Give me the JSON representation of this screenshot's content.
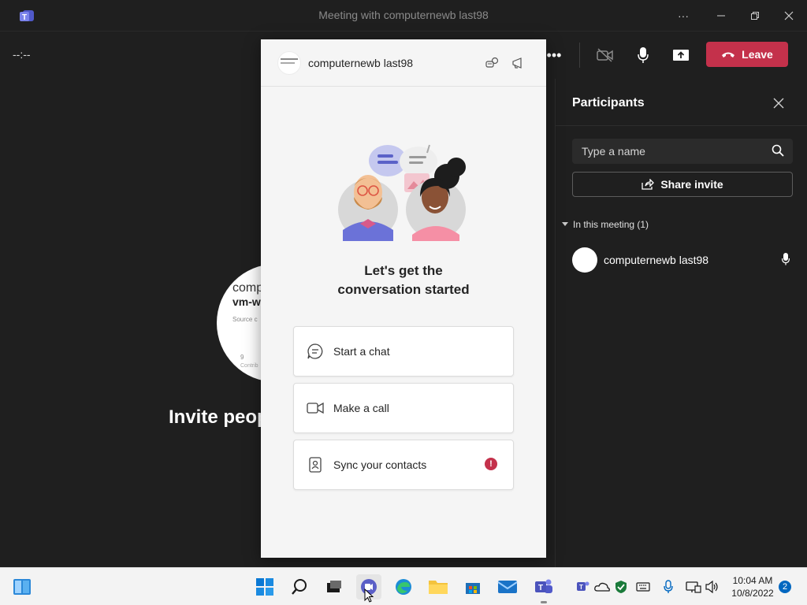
{
  "window": {
    "title": "Meeting with computernewb last98",
    "app_icon": "teams-icon"
  },
  "meeting_bar": {
    "timer": "--:--",
    "leave_label": "Leave",
    "leave_color": "#c4314b"
  },
  "stage": {
    "invite_text": "Invite peop",
    "avatar_lines": [
      "comp",
      "vm-w",
      "Source c",
      "9",
      "Contrib"
    ]
  },
  "participants_panel": {
    "title": "Participants",
    "search_placeholder": "Type a name",
    "share_invite_label": "Share invite",
    "section_label": "In this meeting (1)",
    "participants": [
      {
        "name": "computernewb last98",
        "mic": "mic-icon"
      }
    ]
  },
  "chat_popup": {
    "contact_name": "computernewb last98",
    "headline_line1": "Let's get the",
    "headline_line2": "conversation started",
    "actions": [
      {
        "label": "Start a chat",
        "icon": "chat-icon"
      },
      {
        "label": "Make a call",
        "icon": "video-icon"
      },
      {
        "label": "Sync your contacts",
        "icon": "contacts-icon",
        "badge": "!"
      }
    ]
  },
  "taskbar": {
    "time": "10:04 AM",
    "date": "10/8/2022",
    "notification_count": "2",
    "apps": [
      "start-icon",
      "search-icon",
      "task-view-icon",
      "teams-chat-icon",
      "edge-icon",
      "file-explorer-icon",
      "store-icon",
      "mail-icon",
      "teams-icon"
    ]
  },
  "colors": {
    "accent": "#6264a7",
    "dark_bg": "#1f1f1f",
    "danger": "#c4314b"
  }
}
